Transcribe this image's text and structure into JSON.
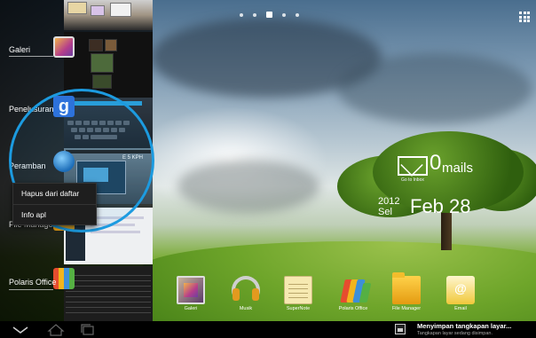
{
  "home": {
    "pager": {
      "pages": 5,
      "active_index": 2
    },
    "mail_widget": {
      "count": "0",
      "label": "mails",
      "sub": "Go to Inbox"
    },
    "clock_widget": {
      "year": "2012",
      "weekday": "Sel",
      "date": "Feb 28"
    },
    "dock": [
      {
        "label": "Galeri",
        "icon": "gallery-icon"
      },
      {
        "label": "Musik",
        "icon": "music-headphones-icon"
      },
      {
        "label": "SuperNote",
        "icon": "supernote-icon"
      },
      {
        "label": "Polaris Office",
        "icon": "polaris-office-icon"
      },
      {
        "label": "File Manager",
        "icon": "folder-icon"
      },
      {
        "label": "Email",
        "icon": "email-icon"
      }
    ]
  },
  "recents": {
    "items": [
      {
        "label": "Galeri",
        "icon": "gallery-icon"
      },
      {
        "label": "Penelusuran",
        "icon": "google-search-icon"
      },
      {
        "label": "Peramban",
        "icon": "browser-globe-icon"
      },
      {
        "label": "File Manager",
        "icon": "folder-icon"
      },
      {
        "label": "Polaris Office",
        "icon": "polaris-office-icon"
      }
    ],
    "browser_thumb_text": "E 5 KPH"
  },
  "context_menu": {
    "items": [
      "Hapus dari daftar",
      "Info apl"
    ]
  },
  "system_bar": {
    "buttons": [
      "back",
      "home",
      "recent-apps"
    ],
    "notification": {
      "title": "Menyimpan tangkapan layar...",
      "subtitle": "Tangkapan layar sedang disimpan."
    }
  },
  "colors": {
    "accent_ring": "#1c9be0",
    "panel_bg": "#000000",
    "menu_bg": "#1e1e1e"
  }
}
